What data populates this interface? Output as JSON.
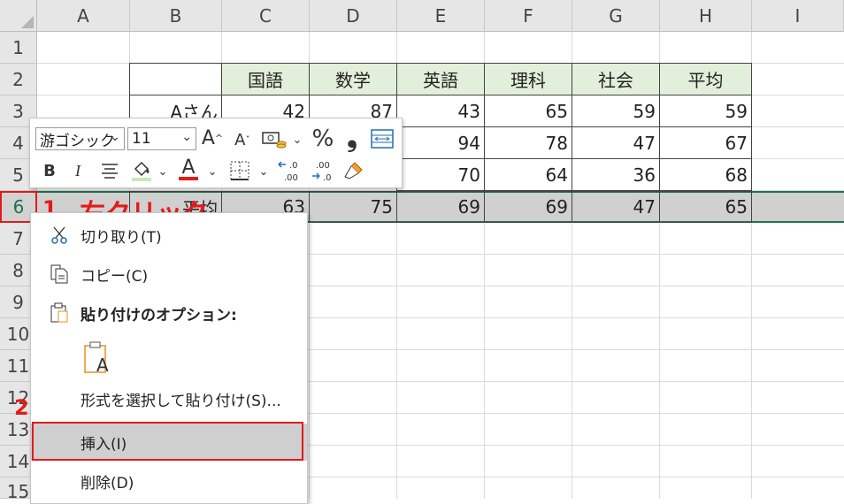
{
  "columns": [
    "A",
    "B",
    "C",
    "D",
    "E",
    "F",
    "G",
    "H",
    "I"
  ],
  "rows": [
    "1",
    "2",
    "3",
    "4",
    "5",
    "6",
    "7",
    "8",
    "9",
    "10",
    "11",
    "12",
    "13",
    "14",
    "15"
  ],
  "table": {
    "headers": [
      "国語",
      "数学",
      "英語",
      "理科",
      "社会",
      "平均"
    ],
    "rows": [
      {
        "name": "Aさん",
        "values": [
          "42",
          "87",
          "43",
          "65",
          "59",
          "59"
        ]
      },
      {
        "name": "",
        "values": [
          "",
          "",
          "94",
          "78",
          "47",
          "67"
        ]
      },
      {
        "name": "",
        "values": [
          "",
          "",
          "70",
          "64",
          "36",
          "68"
        ]
      },
      {
        "name": "平均",
        "values": [
          "63",
          "75",
          "69",
          "69",
          "47",
          "65"
        ]
      }
    ]
  },
  "mini_toolbar": {
    "font_name": "游ゴシック",
    "font_size": "11",
    "row1_icons": [
      "increase-font-icon",
      "decrease-font-icon",
      "accounting-format-icon",
      "percent-icon",
      "comma-icon",
      "wrap-text-icon"
    ],
    "row2_icons": [
      "bold-icon",
      "italic-icon",
      "align-center-icon",
      "fill-color-icon",
      "font-color-icon",
      "borders-icon",
      "increase-decimal-icon",
      "decrease-decimal-icon",
      "format-painter-icon"
    ],
    "bold": "B",
    "italic": "I",
    "font_color_label": "A",
    "percent": "%",
    "comma": "❟",
    "increase_font": "A",
    "decrease_font": "A",
    "dec_inc": ".0\n.00",
    "dec_dec": ".00\n.0"
  },
  "context_menu": {
    "cut": "切り取り(T)",
    "copy": "コピー(C)",
    "paste_options": "貼り付けのオプション:",
    "paste_special": "形式を選択して貼り付け(S)...",
    "insert": "挿入(I)",
    "delete": "削除(D)",
    "paste_icon_letter": "A"
  },
  "annotations": {
    "step1": "1",
    "step1_text": "右クリック",
    "step2": "2"
  },
  "colors": {
    "accent": "#217346",
    "header_fill": "#e2efda",
    "annotation_red": "#e31a1a",
    "selection_gray": "#d0d0d0"
  }
}
